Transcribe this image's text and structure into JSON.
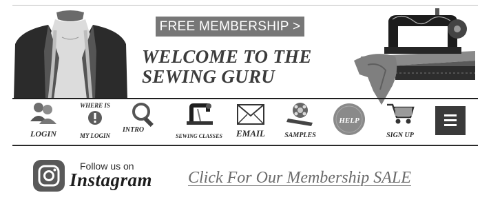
{
  "header": {
    "free_membership_label": "FREE MEMBERSHIP >",
    "welcome_line1": "WELCOME TO THE",
    "welcome_line2": "SEWING GURU"
  },
  "nav": {
    "items": [
      {
        "label": "LOGIN",
        "icon": "users-icon"
      },
      {
        "label_top": "WHERE IS",
        "label": "MY LOGIN",
        "icon": "info-icon"
      },
      {
        "label": "INTRO",
        "icon": "magnifier-icon"
      },
      {
        "label": "SEWING CLASSES",
        "icon": "sewing-machine-icon"
      },
      {
        "label": "EMAIL",
        "icon": "envelope-icon"
      },
      {
        "label": "SAMPLES",
        "icon": "film-reel-icon"
      },
      {
        "label": "HELP",
        "icon": "help-icon"
      },
      {
        "label": "SIGN UP",
        "icon": "cart-icon"
      }
    ],
    "menu_icon": "hamburger-menu-icon"
  },
  "social": {
    "follow_text": "Follow us on",
    "network": "Instagram"
  },
  "promo": {
    "sale_link": "Click For Our Membership SALE"
  }
}
